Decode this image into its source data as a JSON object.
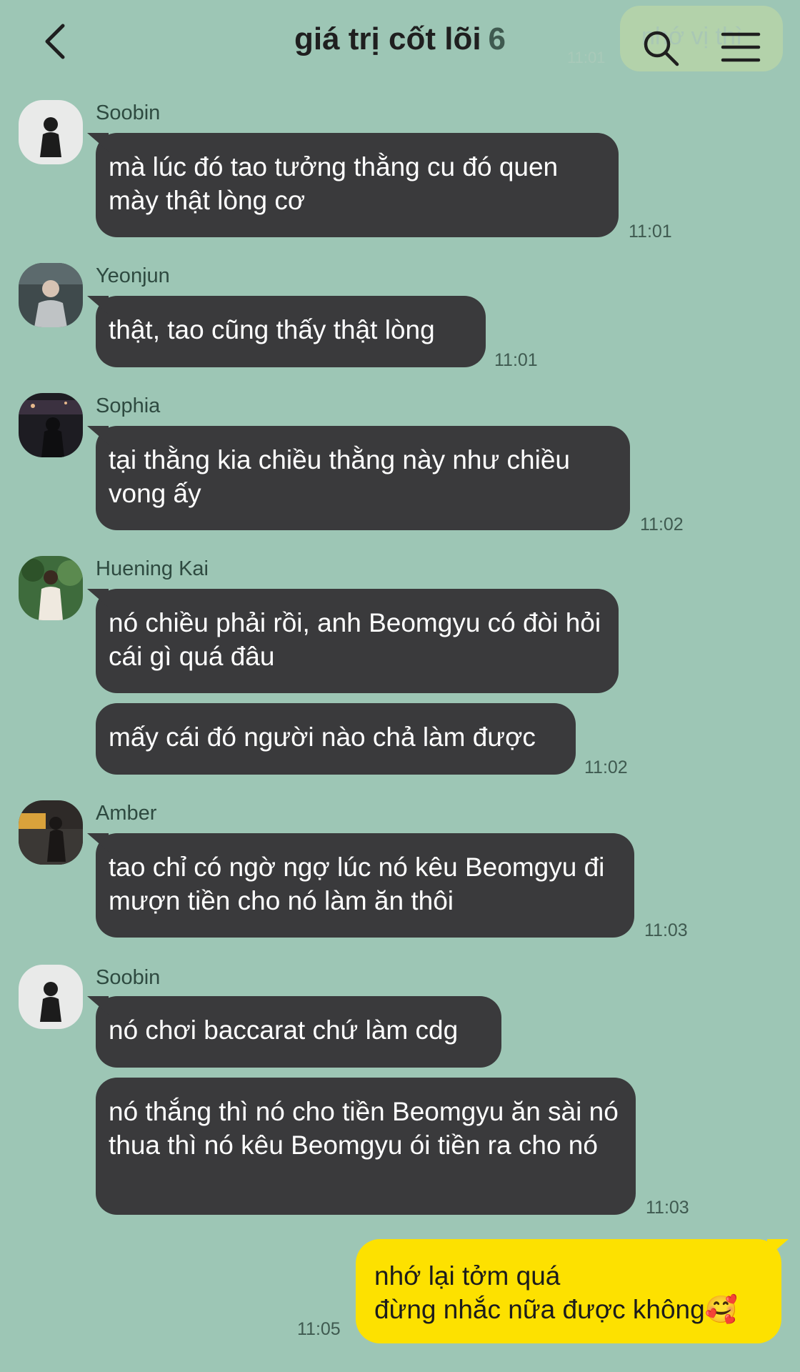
{
  "header": {
    "title": "giá trị cốt lõi",
    "member_count": "6",
    "ghost_text": "nhớ vị thì",
    "ghost_time": "11:01"
  },
  "messages": [
    {
      "sender": "Soobin",
      "bubbles": [
        "mà lúc đó tao tưởng thằng cu đó quen mày thật lòng cơ"
      ],
      "time": "11:01"
    },
    {
      "sender": "Yeonjun",
      "bubbles": [
        "thật, tao cũng thấy thật lòng"
      ],
      "time": "11:01"
    },
    {
      "sender": "Sophia",
      "bubbles": [
        "tại thằng kia chiều thằng này như chiều vong ấy"
      ],
      "time": "11:02"
    },
    {
      "sender": "Huening Kai",
      "bubbles": [
        "nó chiều phải rồi, anh Beomgyu có đòi hỏi cái gì quá đâu",
        "mấy cái đó người nào chả làm được"
      ],
      "time": "11:02"
    },
    {
      "sender": "Amber",
      "bubbles": [
        "tao chỉ có ngờ ngợ lúc nó kêu Beomgyu đi mượn tiền cho nó làm ăn thôi"
      ],
      "time": "11:03"
    },
    {
      "sender": "Soobin",
      "bubbles": [
        "nó chơi baccarat chứ làm cdg",
        "nó thắng thì nó cho tiền Beomgyu ăn sài nó thua thì nó kêu Beomgyu ói tiền ra cho nó"
      ],
      "time": "11:03"
    }
  ],
  "my_message": {
    "line1": "nhớ lại tởm quá",
    "line2": "đừng nhắc nữa được không",
    "emoji": "🥰",
    "time": "11:05"
  },
  "colors": {
    "background": "#9dc6b5",
    "bubble_other": "#3a3a3c",
    "bubble_mine": "#fde100"
  }
}
